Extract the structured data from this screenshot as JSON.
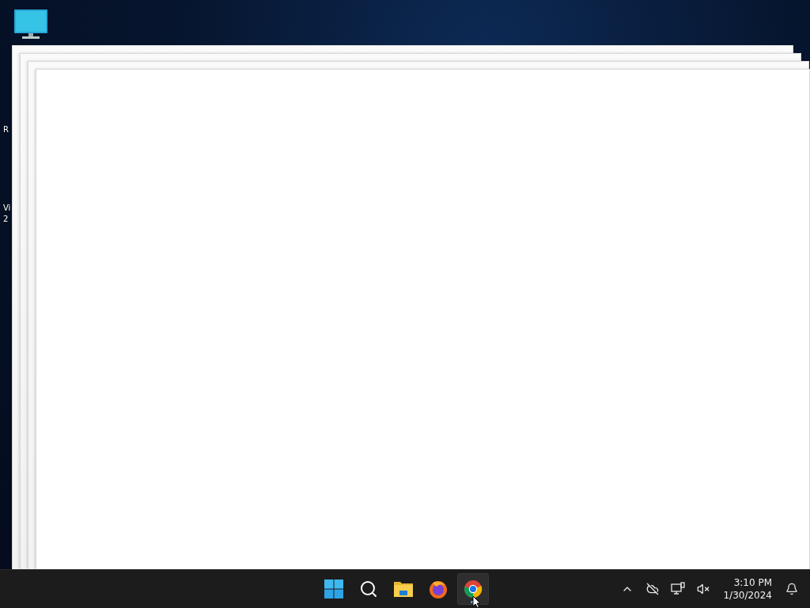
{
  "desktop": {
    "labels": [
      {
        "lines": [
          "R"
        ]
      },
      {
        "lines": [
          "Vi",
          "2"
        ]
      }
    ]
  },
  "taskbar": {
    "apps": [
      {
        "kind": "start",
        "selected": false
      },
      {
        "kind": "search",
        "selected": false
      },
      {
        "kind": "explorer",
        "selected": false
      },
      {
        "kind": "firefox",
        "selected": false
      },
      {
        "kind": "chrome",
        "selected": true
      }
    ],
    "clock": {
      "time": "3:10 PM",
      "date": "1/30/2024"
    }
  }
}
